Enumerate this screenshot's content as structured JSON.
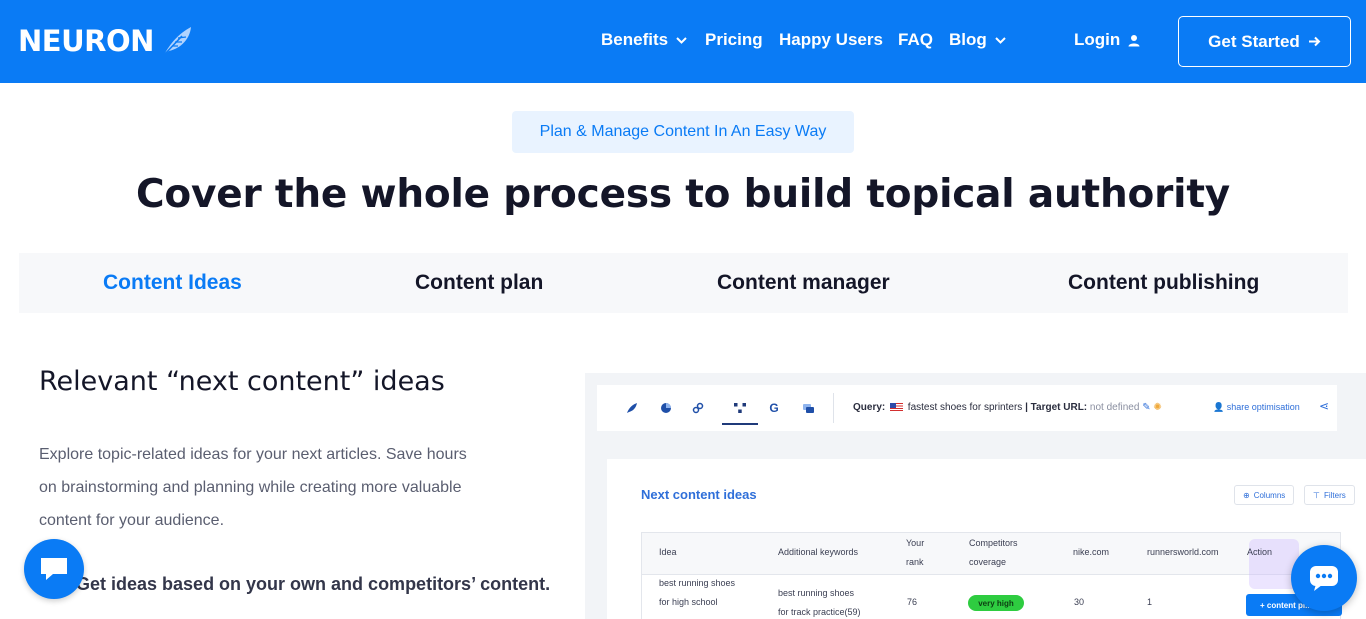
{
  "brand": {
    "name": "NEURON"
  },
  "nav": {
    "items": [
      {
        "label": "Benefits",
        "has_dropdown": true
      },
      {
        "label": "Pricing",
        "has_dropdown": false
      },
      {
        "label": "Happy Users",
        "has_dropdown": false
      },
      {
        "label": "FAQ",
        "has_dropdown": false
      },
      {
        "label": "Blog",
        "has_dropdown": true
      }
    ],
    "login": "Login",
    "cta": "Get Started"
  },
  "hero": {
    "pill": "Plan & Manage Content In An Easy Way",
    "title": "Cover the whole process to build topical authority"
  },
  "tabs": [
    {
      "label": "Content Ideas",
      "active": true
    },
    {
      "label": "Content plan",
      "active": false
    },
    {
      "label": "Content manager",
      "active": false
    },
    {
      "label": "Content publishing",
      "active": false
    }
  ],
  "feature": {
    "title": "Relevant “next content” ideas",
    "description": "Explore topic-related ideas for your next articles. Save hours on brainstorming and planning while creating more valuable content for your audience.",
    "bullet": "Get ideas based on your own and competitors’ content."
  },
  "app": {
    "query_label": "Query:",
    "query_value": "fastest shoes for sprinters",
    "target_label": "| Target URL:",
    "target_value": "not defined",
    "share": "share optimisation",
    "panel_title": "Next content ideas",
    "chips": {
      "columns": "Columns",
      "filters": "Filters"
    },
    "table": {
      "headers": {
        "idea": "Idea",
        "additional_keywords": "Additional keywords",
        "your_rank_1": "Your",
        "your_rank_2": "rank",
        "competitors_1": "Competitors",
        "competitors_2": "coverage",
        "nike": "nike.com",
        "runnersworld": "runnersworld.com",
        "action": "Action"
      },
      "row": {
        "idea_1": "best running shoes",
        "idea_2": "for high school",
        "keyword_1": "best running shoes",
        "keyword_2": "for track practice(59)",
        "rank": "76",
        "coverage": "very high",
        "nike": "30",
        "runnersworld": "1",
        "action": "+ content pl..."
      }
    }
  },
  "colors": {
    "primary": "#0a7bf5",
    "pill_bg": "#e9f3ff",
    "badge_green": "#2ecc40"
  }
}
